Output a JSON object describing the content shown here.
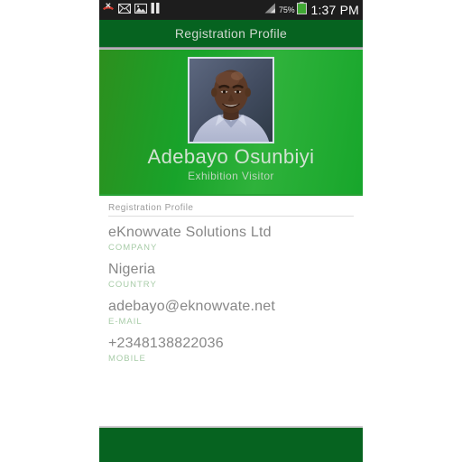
{
  "status_bar": {
    "icons": [
      {
        "name": "missed-call-icon"
      },
      {
        "name": "envelope-icon"
      },
      {
        "name": "image-icon"
      },
      {
        "name": "pause-icon"
      }
    ],
    "signal_icon": "signal-bars-icon",
    "battery_percent": "75%",
    "battery_icon": "battery-icon",
    "time": "1:37 PM"
  },
  "action_bar": {
    "title": "Registration Profile"
  },
  "hero": {
    "avatar_alt": "profile-photo",
    "name": "Adebayo Osunbiyi",
    "role": "Exhibition Visitor"
  },
  "details": {
    "section_header": "Registration Profile",
    "fields": [
      {
        "value": "eKnowvate Solutions Ltd",
        "label": "COMPANY"
      },
      {
        "value": "Nigeria",
        "label": "COUNTRY"
      },
      {
        "value": "adebayo@eknowvate.net",
        "label": "E-MAIL"
      },
      {
        "value": "+2348138822036",
        "label": "MOBILE"
      }
    ]
  },
  "colors": {
    "action_bar_green": "#066320",
    "hero_green_light": "#2fb23b",
    "hero_green_dark": "#2d8f1e",
    "label_green": "#a8cca8",
    "value_gray": "#878787",
    "status_bar_dark": "#1d1d1d"
  }
}
